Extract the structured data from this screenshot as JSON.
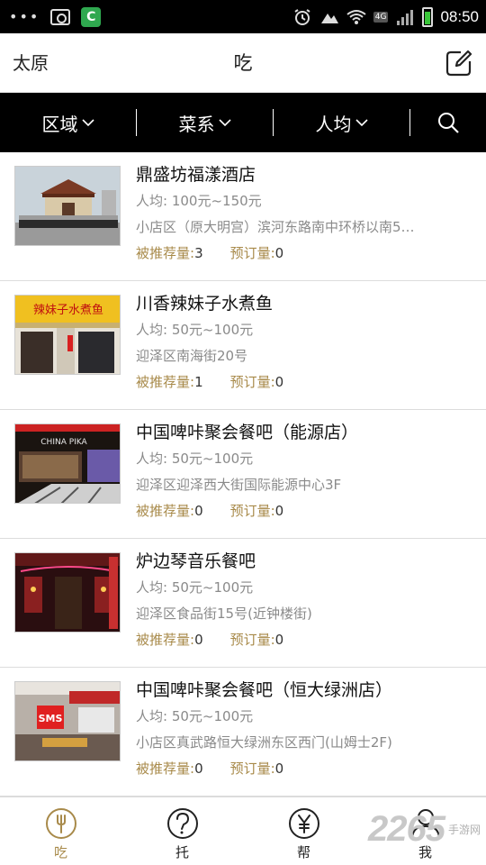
{
  "status_bar": {
    "dots": "•••",
    "app_badge": "C",
    "network": "4G",
    "time": "08:50"
  },
  "header": {
    "city": "太原",
    "title": "吃"
  },
  "filters": {
    "area": "区域",
    "cuisine": "菜系",
    "per_person": "人均"
  },
  "labels": {
    "recommended": "被推荐量: ",
    "booked": "预订量: "
  },
  "restaurants": [
    {
      "name": "鼎盛坊福漾酒店",
      "price": "人均: 100元~150元",
      "address": "小店区（原大明宫）滨河东路南中环桥以南5…",
      "recommended": "3",
      "booked": "0"
    },
    {
      "name": "川香辣妹子水煮鱼",
      "price": "人均: 50元~100元",
      "address": "迎泽区南海街20号",
      "recommended": "1",
      "booked": "0"
    },
    {
      "name": "中国啤咔聚会餐吧（能源店）",
      "price": "人均: 50元~100元",
      "address": "迎泽区迎泽西大街国际能源中心3F",
      "recommended": "0",
      "booked": "0"
    },
    {
      "name": "炉边琴音乐餐吧",
      "price": "人均: 50元~100元",
      "address": "迎泽区食品街15号(近钟楼街)",
      "recommended": "0",
      "booked": "0"
    },
    {
      "name": "中国啤咔聚会餐吧（恒大绿洲店）",
      "price": "人均: 50元~100元",
      "address": "小店区真武路恒大绿洲东区西门(山姆士2F)",
      "recommended": "0",
      "booked": "0"
    }
  ],
  "thumb_text": {
    "r2_sign": "辣妹子水煮鱼",
    "r3_sign": "CHINA PIKA",
    "r5_sign": "SMS"
  },
  "nav": [
    {
      "label": "吃",
      "icon": "fork-icon",
      "active": true
    },
    {
      "label": "托",
      "icon": "question-icon",
      "active": false
    },
    {
      "label": "帮",
      "icon": "yuan-icon",
      "active": false
    },
    {
      "label": "我",
      "icon": "user-icon",
      "active": false
    }
  ],
  "watermark": {
    "number": "2265",
    "text": "手游网"
  },
  "colors": {
    "accent": "#a88a4a",
    "filter_bar": "#000000",
    "status_bar": "#000000"
  }
}
